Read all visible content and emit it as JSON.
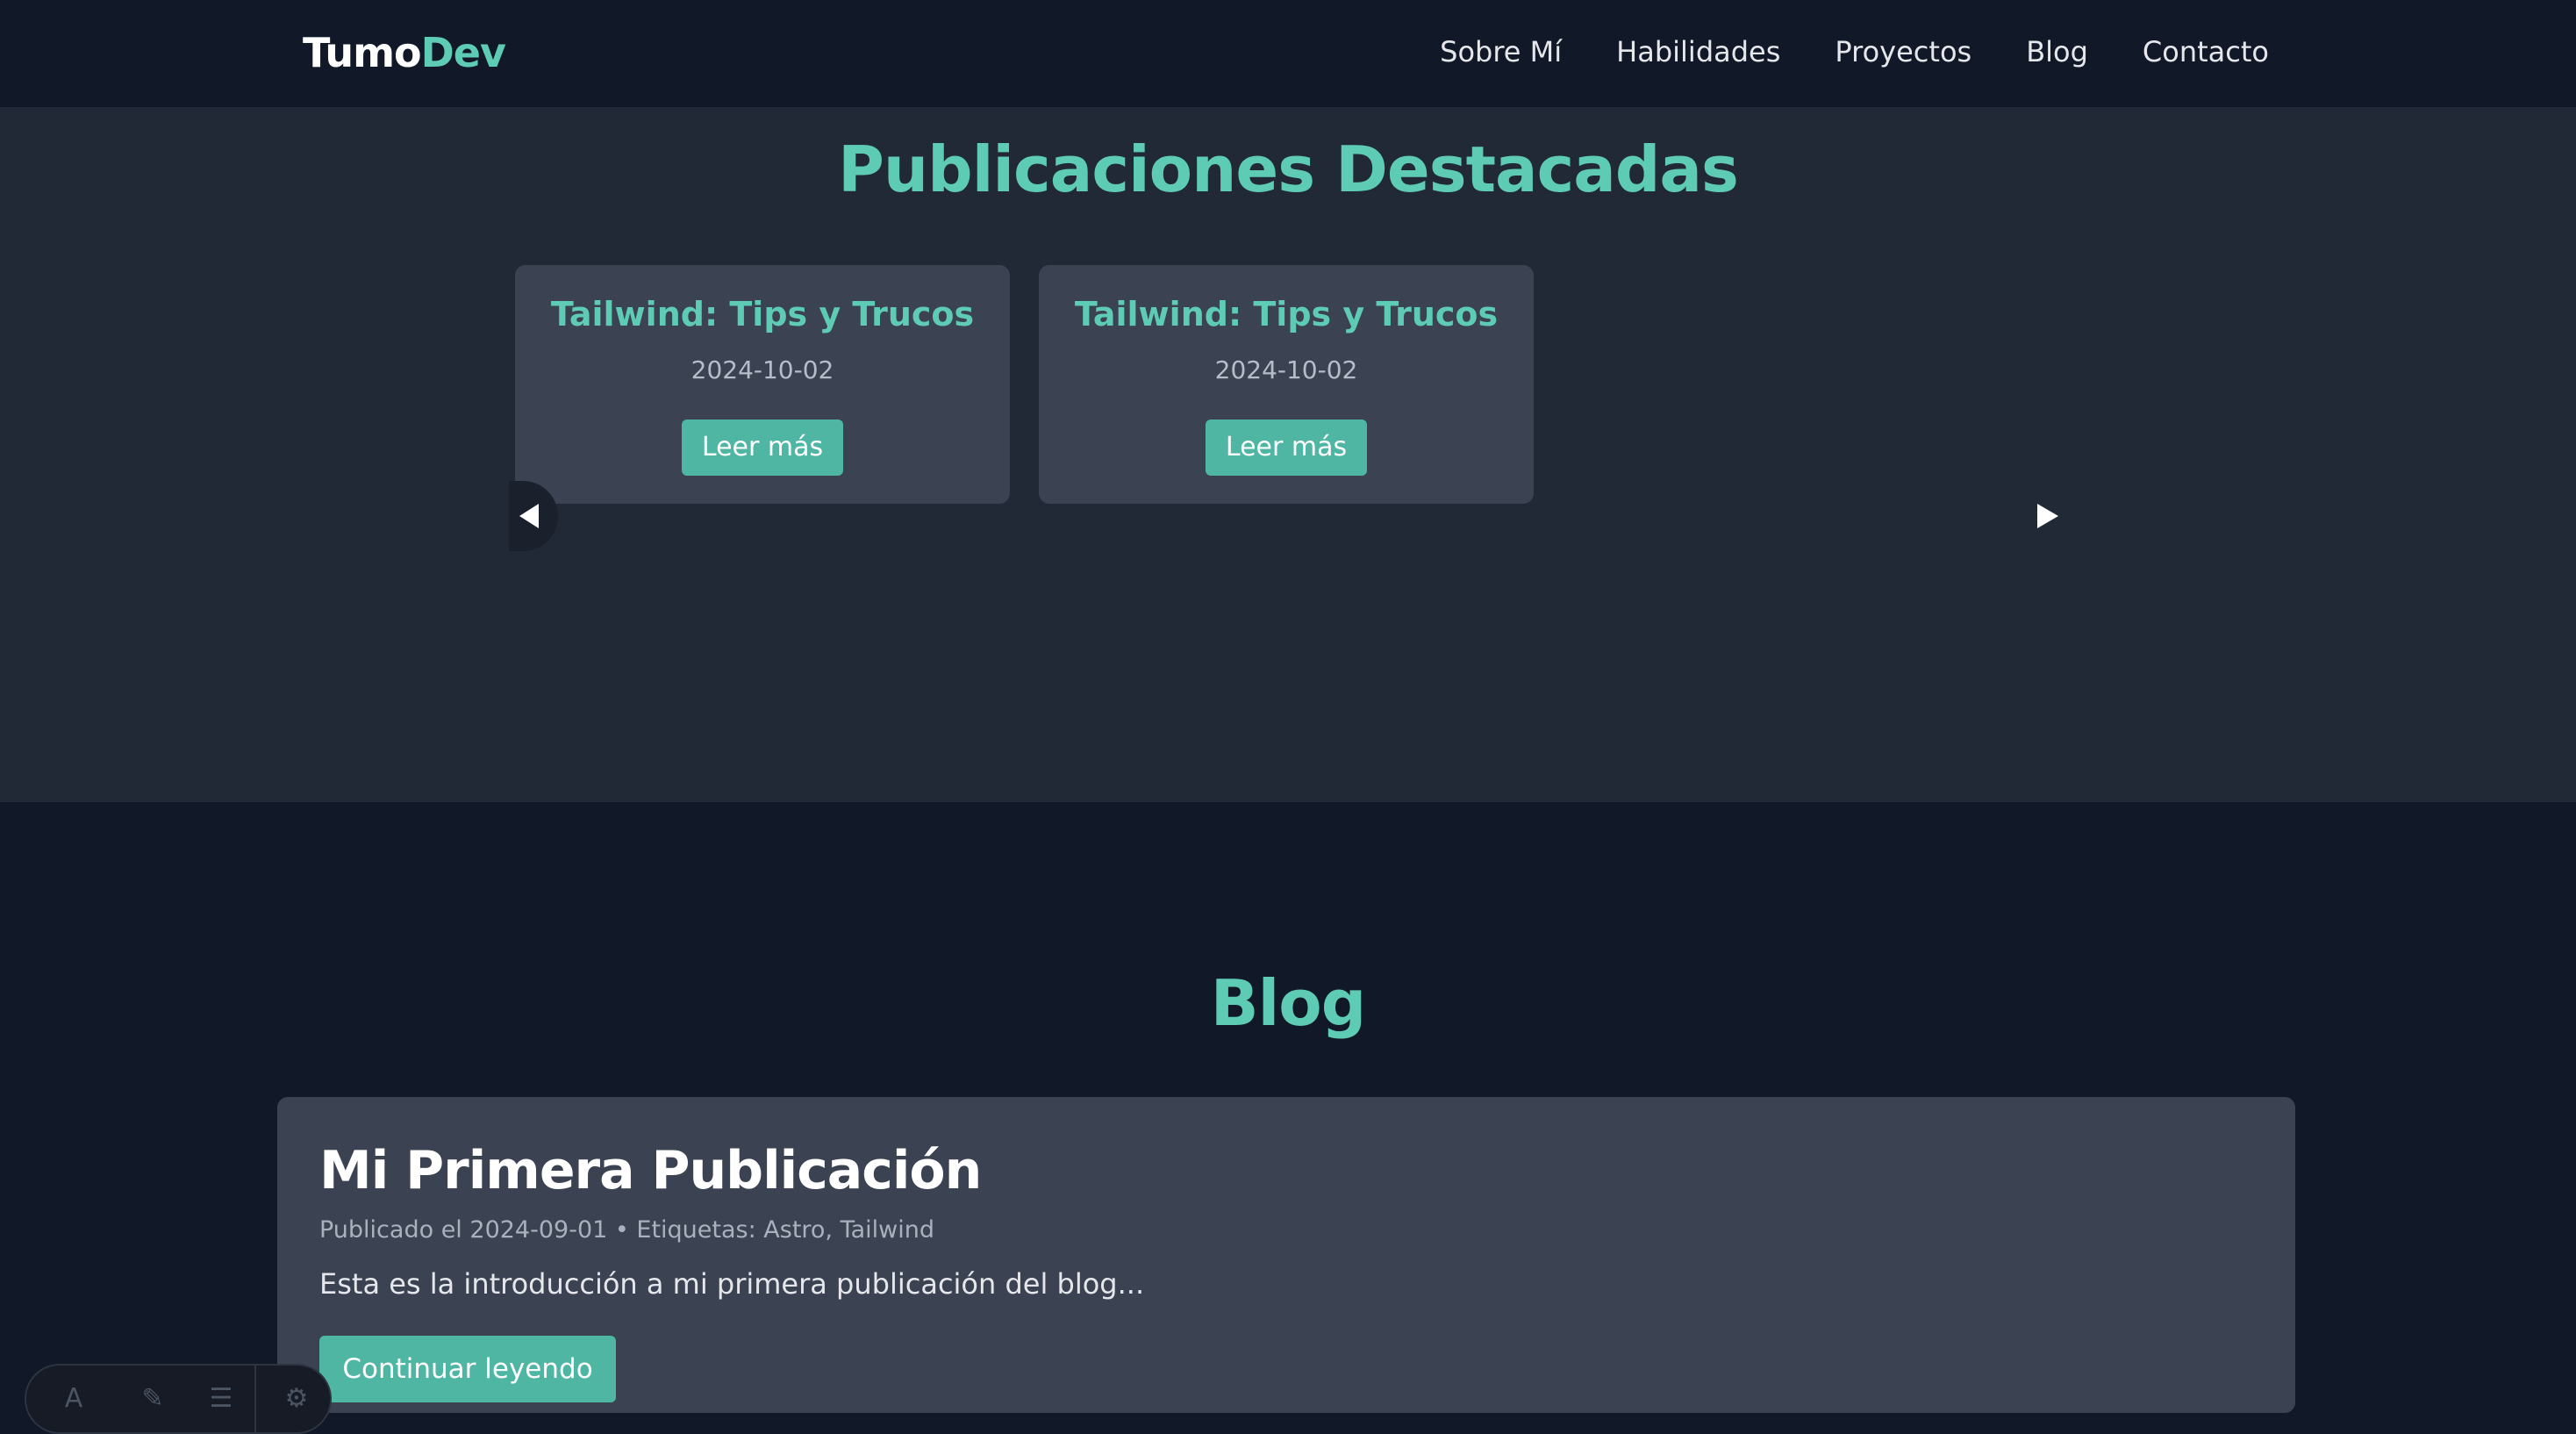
{
  "header": {
    "logo_part1": "Tumo",
    "logo_part2": "Dev",
    "nav": [
      "Sobre Mí",
      "Habilidades",
      "Proyectos",
      "Blog",
      "Contacto"
    ]
  },
  "featured": {
    "title": "Publicaciones Destacadas",
    "cards": [
      {
        "title": "Tailwind: Tips y Trucos",
        "date": "2024-10-02",
        "button": "Leer más"
      },
      {
        "title": "Tailwind: Tips y Trucos",
        "date": "2024-10-02",
        "button": "Leer más"
      }
    ],
    "prev_icon": "chevron-left-icon",
    "next_icon": "chevron-right-icon"
  },
  "blog": {
    "title": "Blog",
    "post": {
      "title": "Mi Primera Publicación",
      "meta": "Publicado el 2024-09-01 • Etiquetas: Astro, Tailwind",
      "excerpt": "Esta es la introducción a mi primera publicación del blog...",
      "button": "Continuar leyendo"
    }
  },
  "toolbar": {
    "icons": [
      "text-icon",
      "pen-icon",
      "menu-icon",
      "settings-icon"
    ]
  },
  "colors": {
    "accent": "#5ecbb5",
    "button": "#4fb6a4",
    "header_bg": "#111827",
    "section_bg": "#222936",
    "card_bg": "#3b4252"
  }
}
